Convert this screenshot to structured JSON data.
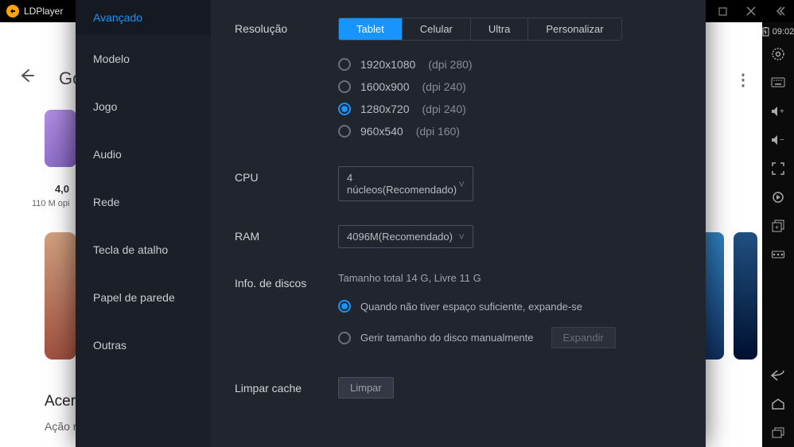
{
  "app": {
    "name": "LDPlayer"
  },
  "statusbar": {
    "time": "09:02"
  },
  "background": {
    "go_text": "Go",
    "rating": "4,0",
    "opinions": "110 M opi",
    "acer": "Acer",
    "acao": "Ação n",
    "more": "⋮"
  },
  "sidebar": {
    "items": [
      {
        "label": "Avançado",
        "active": true
      },
      {
        "label": "Modelo"
      },
      {
        "label": "Jogo"
      },
      {
        "label": "Audio"
      },
      {
        "label": "Rede"
      },
      {
        "label": "Tecla de atalho"
      },
      {
        "label": "Papel de parede"
      },
      {
        "label": "Outras"
      }
    ]
  },
  "settings": {
    "resolution": {
      "label": "Resolução",
      "tabs": [
        {
          "label": "Tablet",
          "active": true
        },
        {
          "label": "Celular"
        },
        {
          "label": "Ultra"
        },
        {
          "label": "Personalizar"
        }
      ],
      "options": [
        {
          "res": "1920x1080",
          "dpi": "(dpi 280)",
          "checked": false
        },
        {
          "res": "1600x900",
          "dpi": "(dpi 240)",
          "checked": false
        },
        {
          "res": "1280x720",
          "dpi": "(dpi 240)",
          "checked": true
        },
        {
          "res": "960x540",
          "dpi": "(dpi 160)",
          "checked": false
        }
      ]
    },
    "cpu": {
      "label": "CPU",
      "value": "4 núcleos(Recomendado)"
    },
    "ram": {
      "label": "RAM",
      "value": "4096M(Recomendado)"
    },
    "disk": {
      "label": "Info. de discos",
      "info": "Tamanho total 14 G,  Livre 11 G",
      "opt_auto": "Quando não tiver espaço suficiente, expande-se",
      "opt_manual": "Gerir tamanho do disco manualmente",
      "expand_btn": "Expandir"
    },
    "cache": {
      "label": "Limpar cache",
      "btn": "Limpar"
    }
  }
}
